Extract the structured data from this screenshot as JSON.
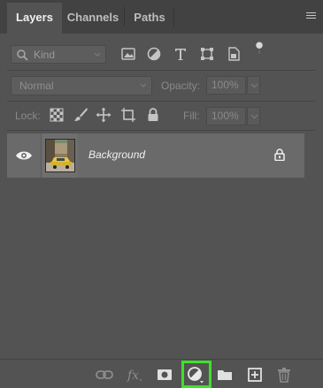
{
  "tabs": [
    {
      "label": "Layers"
    },
    {
      "label": "Channels"
    },
    {
      "label": "Paths"
    }
  ],
  "filter": {
    "kind_label": "Kind",
    "icons": [
      "image-filter-icon",
      "adjustment-filter-icon",
      "type-filter-icon",
      "shape-filter-icon",
      "smart-object-filter-icon",
      "filter-toggle-icon"
    ]
  },
  "blend": {
    "mode": "Normal",
    "opacity_label": "Opacity:",
    "opacity_value": "100%"
  },
  "lock": {
    "label": "Lock:",
    "fill_label": "Fill:",
    "fill_value": "100%"
  },
  "layers": [
    {
      "name": "Background",
      "visible": true,
      "locked": true
    }
  ],
  "bottom_toolbar": {
    "icons": [
      "link-layers-icon",
      "fx-icon",
      "add-mask-icon",
      "new-adjustment-layer-icon",
      "new-group-icon",
      "new-layer-icon",
      "delete-layer-icon"
    ],
    "highlight_color": "#3fe12a"
  },
  "colors": {
    "panel_bg": "#535353",
    "tab_bar_bg": "#424242",
    "selected_layer_bg": "#6a6a6a"
  }
}
